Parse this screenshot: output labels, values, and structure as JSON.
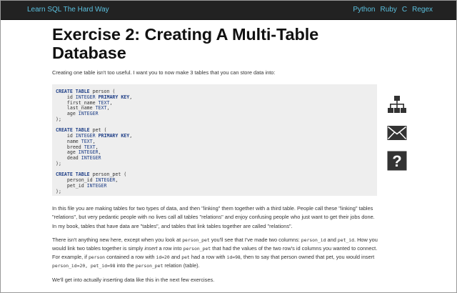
{
  "nav": {
    "brand": "Learn SQL The Hard Way",
    "links": [
      "Python",
      "Ruby",
      "C",
      "Regex"
    ]
  },
  "title": "Exercise 2: Creating A Multi-Table Database",
  "intro": "Creating one table isn't too useful. I want you to now make 3 tables that you can store data into:",
  "code": [
    {
      "name": "person",
      "columns": [
        {
          "col": "id",
          "type": "INTEGER PRIMARY KEY"
        },
        {
          "col": "first_name",
          "type": "TEXT"
        },
        {
          "col": "last_name",
          "type": "TEXT"
        },
        {
          "col": "age",
          "type": "INTEGER"
        }
      ]
    },
    {
      "name": "pet",
      "columns": [
        {
          "col": "id",
          "type": "INTEGER PRIMARY KEY"
        },
        {
          "col": "name",
          "type": "TEXT"
        },
        {
          "col": "breed",
          "type": "TEXT"
        },
        {
          "col": "age",
          "type": "INTEGER"
        },
        {
          "col": "dead",
          "type": "INTEGER"
        }
      ]
    },
    {
      "name": "person_pet",
      "columns": [
        {
          "col": "person_id",
          "type": "INTEGER"
        },
        {
          "col": "pet_id",
          "type": "INTEGER"
        }
      ]
    }
  ],
  "paragraph2": "In this file you are making tables for two types of data, and then \"linking\" them together with a third table. People call these \"linking\" tables \"relations\", but very pedantic people with no lives call all tables \"relations\" and enjoy confusing people who just want to get their jobs done. In my book, tables that have data are \"tables\", and tables that link tables together are called \"relations\".",
  "paragraph3": {
    "t1": "There isn't anything new here, except when you look at ",
    "c1": "person_pet",
    "t2": " you'll see that I've made two columns: ",
    "c2": "person_id",
    "t3": " and ",
    "c3": "pet_id",
    "t4": ". How you would link two tables together is simply ",
    "em": "insert",
    "t5": " a row into ",
    "c4": "person_pet",
    "t6": " that had the values of the two row's id columns you wanted to connect. For example, if ",
    "c5": "person",
    "t7": " contained a row with ",
    "c6": "id=20",
    "t8": " and ",
    "c7": "pet",
    "t9": " had a row with ",
    "c8": "id=98",
    "t10": ", then to say that person owned that pet, you would insert ",
    "c9": "person_id=20, pet_id=98",
    "t11": " into the ",
    "c10": "person_pet",
    "t12": " relation (table)."
  },
  "paragraph4": "We'll get into actually inserting data like this in the next few exercises.",
  "icons": {
    "names": [
      "sitemap-icon",
      "envelope-icon",
      "question-icon"
    ],
    "color": "#333333"
  }
}
